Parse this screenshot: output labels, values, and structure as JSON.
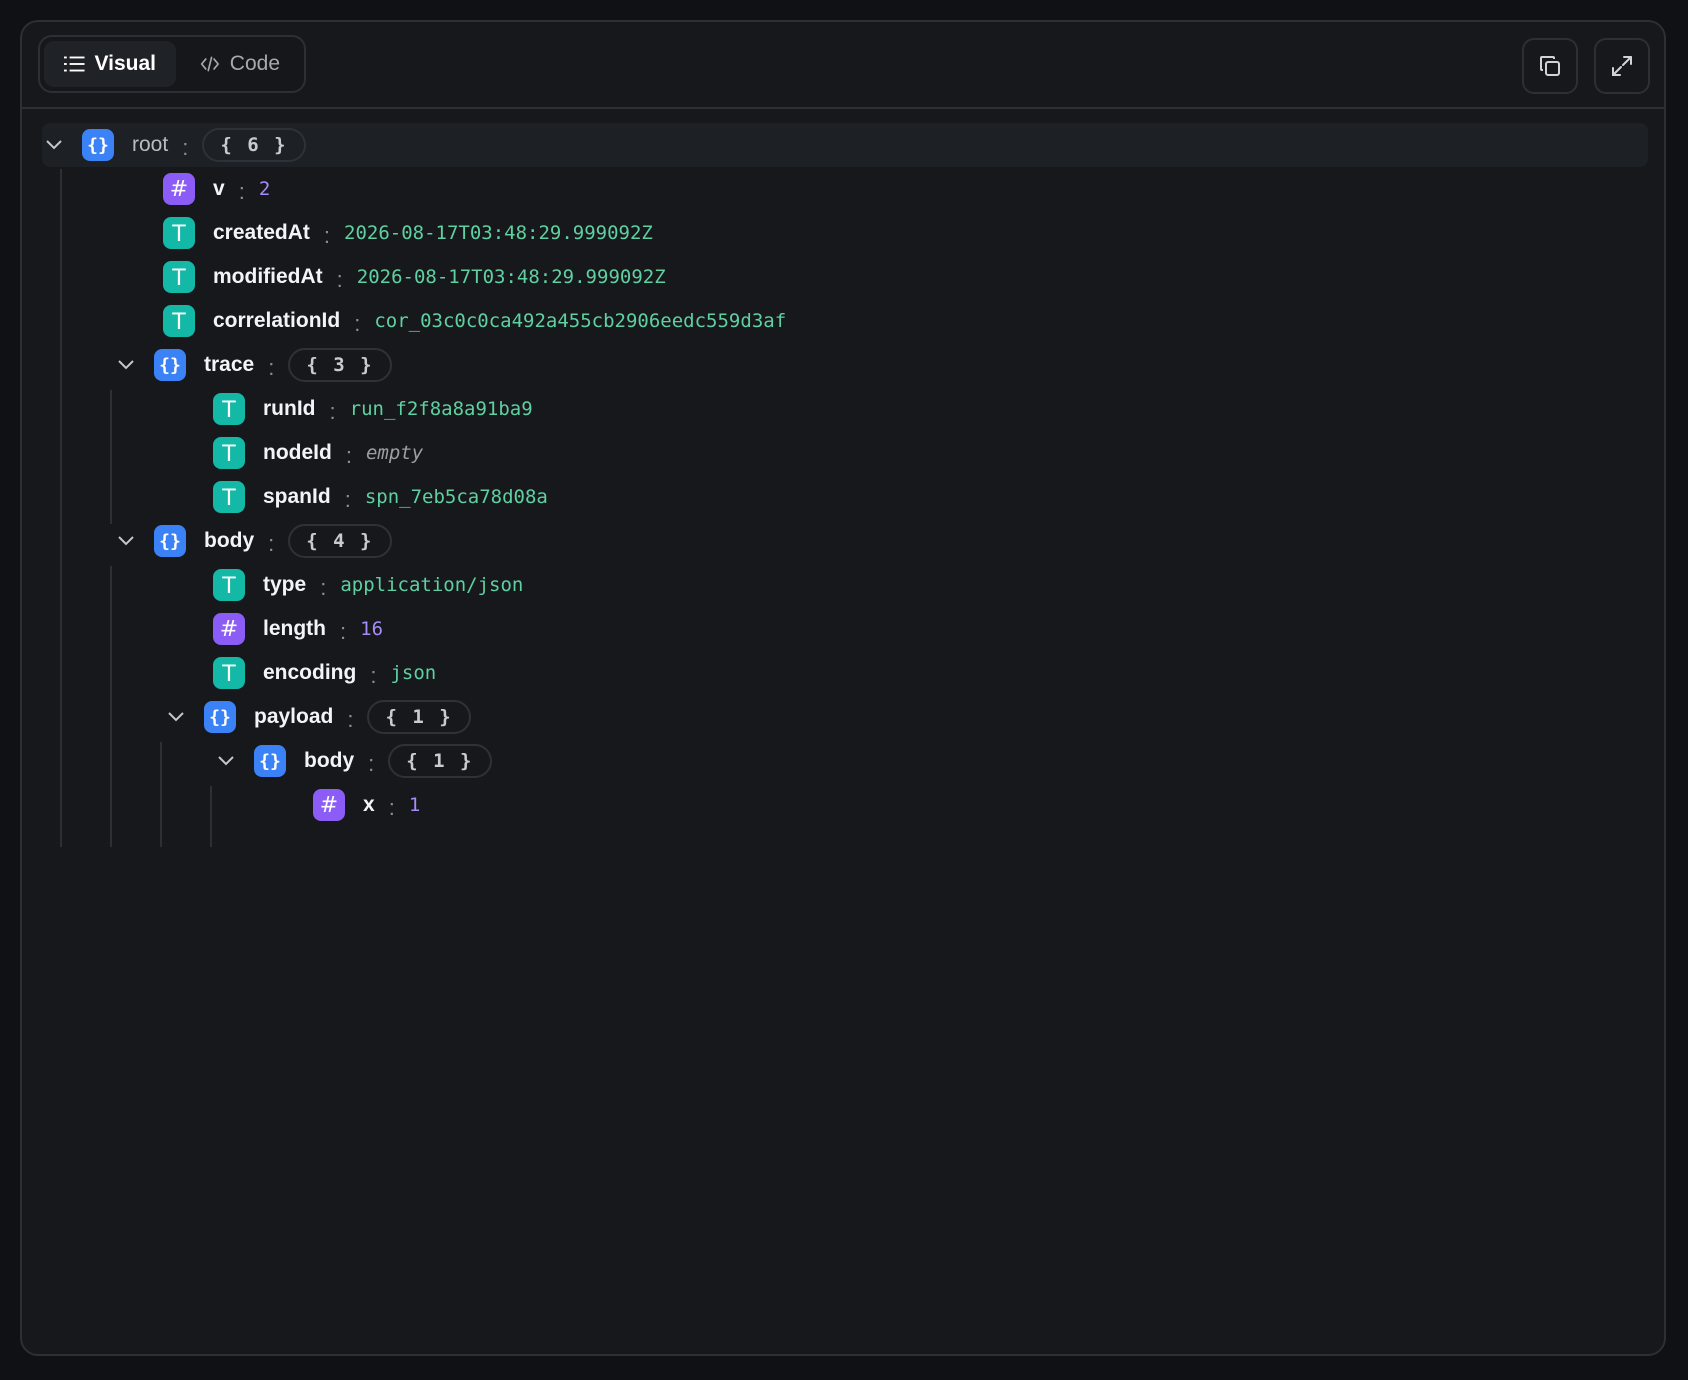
{
  "toolbar": {
    "tabs": [
      {
        "label": "Visual",
        "icon": "list-icon",
        "active": true
      },
      {
        "label": "Code",
        "icon": "code-icon",
        "active": false
      }
    ],
    "actions": [
      {
        "name": "copy-button",
        "icon": "copy-icon"
      },
      {
        "name": "expand-button",
        "icon": "expand-icon"
      }
    ]
  },
  "tree": {
    "root": {
      "key": "root",
      "count": "{ 6 }"
    },
    "v": {
      "key": "v",
      "value": "2"
    },
    "createdAt": {
      "key": "createdAt",
      "value": "2026-08-17T03:48:29.999092Z"
    },
    "modifiedAt": {
      "key": "modifiedAt",
      "value": "2026-08-17T03:48:29.999092Z"
    },
    "correlationId": {
      "key": "correlationId",
      "value": "cor_03c0c0ca492a455cb2906eedc559d3af"
    },
    "trace": {
      "key": "trace",
      "count": "{ 3 }"
    },
    "runId": {
      "key": "runId",
      "value": "run_f2f8a8a91ba9"
    },
    "nodeId": {
      "key": "nodeId",
      "value": "empty"
    },
    "spanId": {
      "key": "spanId",
      "value": "spn_7eb5ca78d08a"
    },
    "body": {
      "key": "body",
      "count": "{ 4 }"
    },
    "type": {
      "key": "type",
      "value": "application/json"
    },
    "length": {
      "key": "length",
      "value": "16"
    },
    "encoding": {
      "key": "encoding",
      "value": "json"
    },
    "payload": {
      "key": "payload",
      "count": "{ 1 }"
    },
    "payloadBody": {
      "key": "body",
      "count": "{ 1 }"
    },
    "x": {
      "key": "x",
      "value": "1"
    }
  },
  "colors": {
    "object": "#3b82f6",
    "number": "#8b5cf6",
    "string": "#14b8a6",
    "stringValue": "#5fd0a0",
    "numberValue": "#a78bfa"
  }
}
